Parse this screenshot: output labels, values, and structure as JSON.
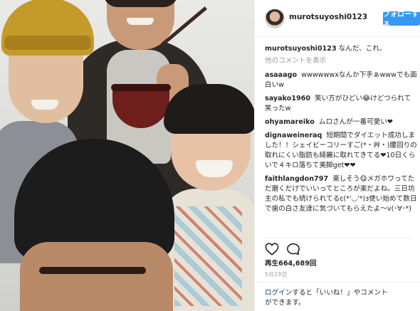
{
  "header": {
    "username": "murotsuyoshi0123",
    "follow_label": "フォローする"
  },
  "caption": {
    "user": "murotsuyoshi0123",
    "text": "なんだ、これ、"
  },
  "more_comments_label": "他のコメントを表示",
  "comments": [
    {
      "user": "asaaago",
      "text": "wwwwwwxなんか下手ぁwwwでも面白いw"
    },
    {
      "user": "sayako1960",
      "text": "笑い方がひどい😂けどつられて笑ったw"
    },
    {
      "user": "ohyamareiko",
      "text": "ムロさんが一番可愛い❤"
    },
    {
      "user": "dignaweineraq",
      "text": "短期間でダイエット成功しました！！シェイビーコリーすご(*・艸・)腰回りの取れにくい脂肪も綺麗に取れてきてる❤10日くらいで４キロ落ちて美脚get❤❤"
    },
    {
      "user": "faithlangdon797",
      "text": "楽しそう😋メガホワってただ磨くだけでいいってところが楽だよね。三日坊主の私でも続けられてるε(*'◡'*)з使い始めて数日で歯の白さ友達に気づいてもらえたよ〜v(･∀･*)"
    }
  ],
  "stats": {
    "plays": "再生664,689回",
    "date": "5月28日"
  },
  "footer": {
    "login_link": "ログイン",
    "text_1": "すると「いいね！」やコメント",
    "text_2": "ができます。"
  },
  "icons": {
    "like": "heart-icon",
    "comment": "comment-icon"
  },
  "colors": {
    "accent": "#3897f0",
    "muted": "#999999"
  }
}
